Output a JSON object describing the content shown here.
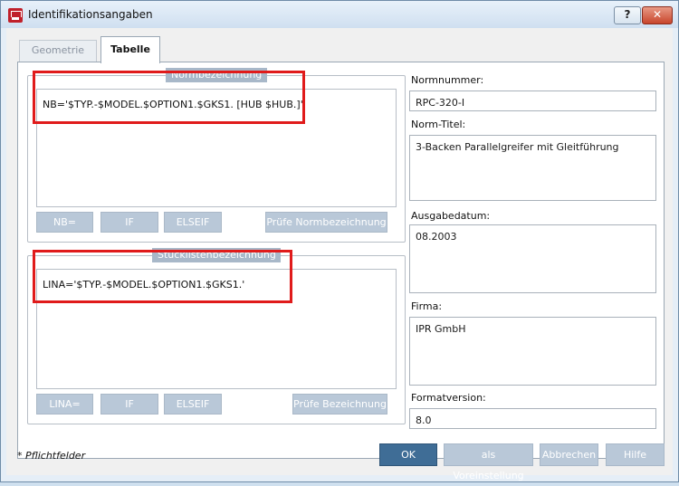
{
  "window": {
    "title": "Identifikationsangaben",
    "help_label": "?",
    "close_label": "✕"
  },
  "tabs": [
    {
      "label": "Geometrie"
    },
    {
      "label": "Tabelle"
    }
  ],
  "norm_group": {
    "legend": "Normbezeichnung",
    "expression": "NB='$TYP.-$MODEL.$OPTION1.$GKS1. [HUB $HUB.]'",
    "buttons": {
      "nb": "NB=",
      "if": "IF",
      "elseif": "ELSEIF",
      "check": "Prüfe Normbezeichnung"
    }
  },
  "stueck_group": {
    "legend": "Stücklistenbezeichnung",
    "expression": "LINA='$TYP.-$MODEL.$OPTION1.$GKS1.'",
    "buttons": {
      "lina": "LINA=",
      "if": "IF",
      "elseif": "ELSEIF",
      "check": "Prüfe Bezeichnung"
    }
  },
  "fields": {
    "normnummer": {
      "label": "Normnummer:",
      "value": "RPC-320-I"
    },
    "norm_titel": {
      "label": "Norm-Titel:",
      "value": "3-Backen Parallelgreifer mit Gleitführung"
    },
    "ausgabedatum": {
      "label": "Ausgabedatum:",
      "value": "08.2003"
    },
    "firma": {
      "label": "Firma:",
      "value": "IPR GmbH"
    },
    "formatversion": {
      "label": "Formatversion:",
      "value": "8.0"
    }
  },
  "footer": {
    "required_note": "* Pflichtfelder",
    "ok": "OK",
    "defaults": "als Voreinstellung",
    "cancel": "Abbrechen",
    "help": "Hilfe"
  },
  "colors": {
    "highlight": "#e01b1b",
    "accent": "#3f6d96",
    "disabled_button": "#b9c8d8"
  }
}
